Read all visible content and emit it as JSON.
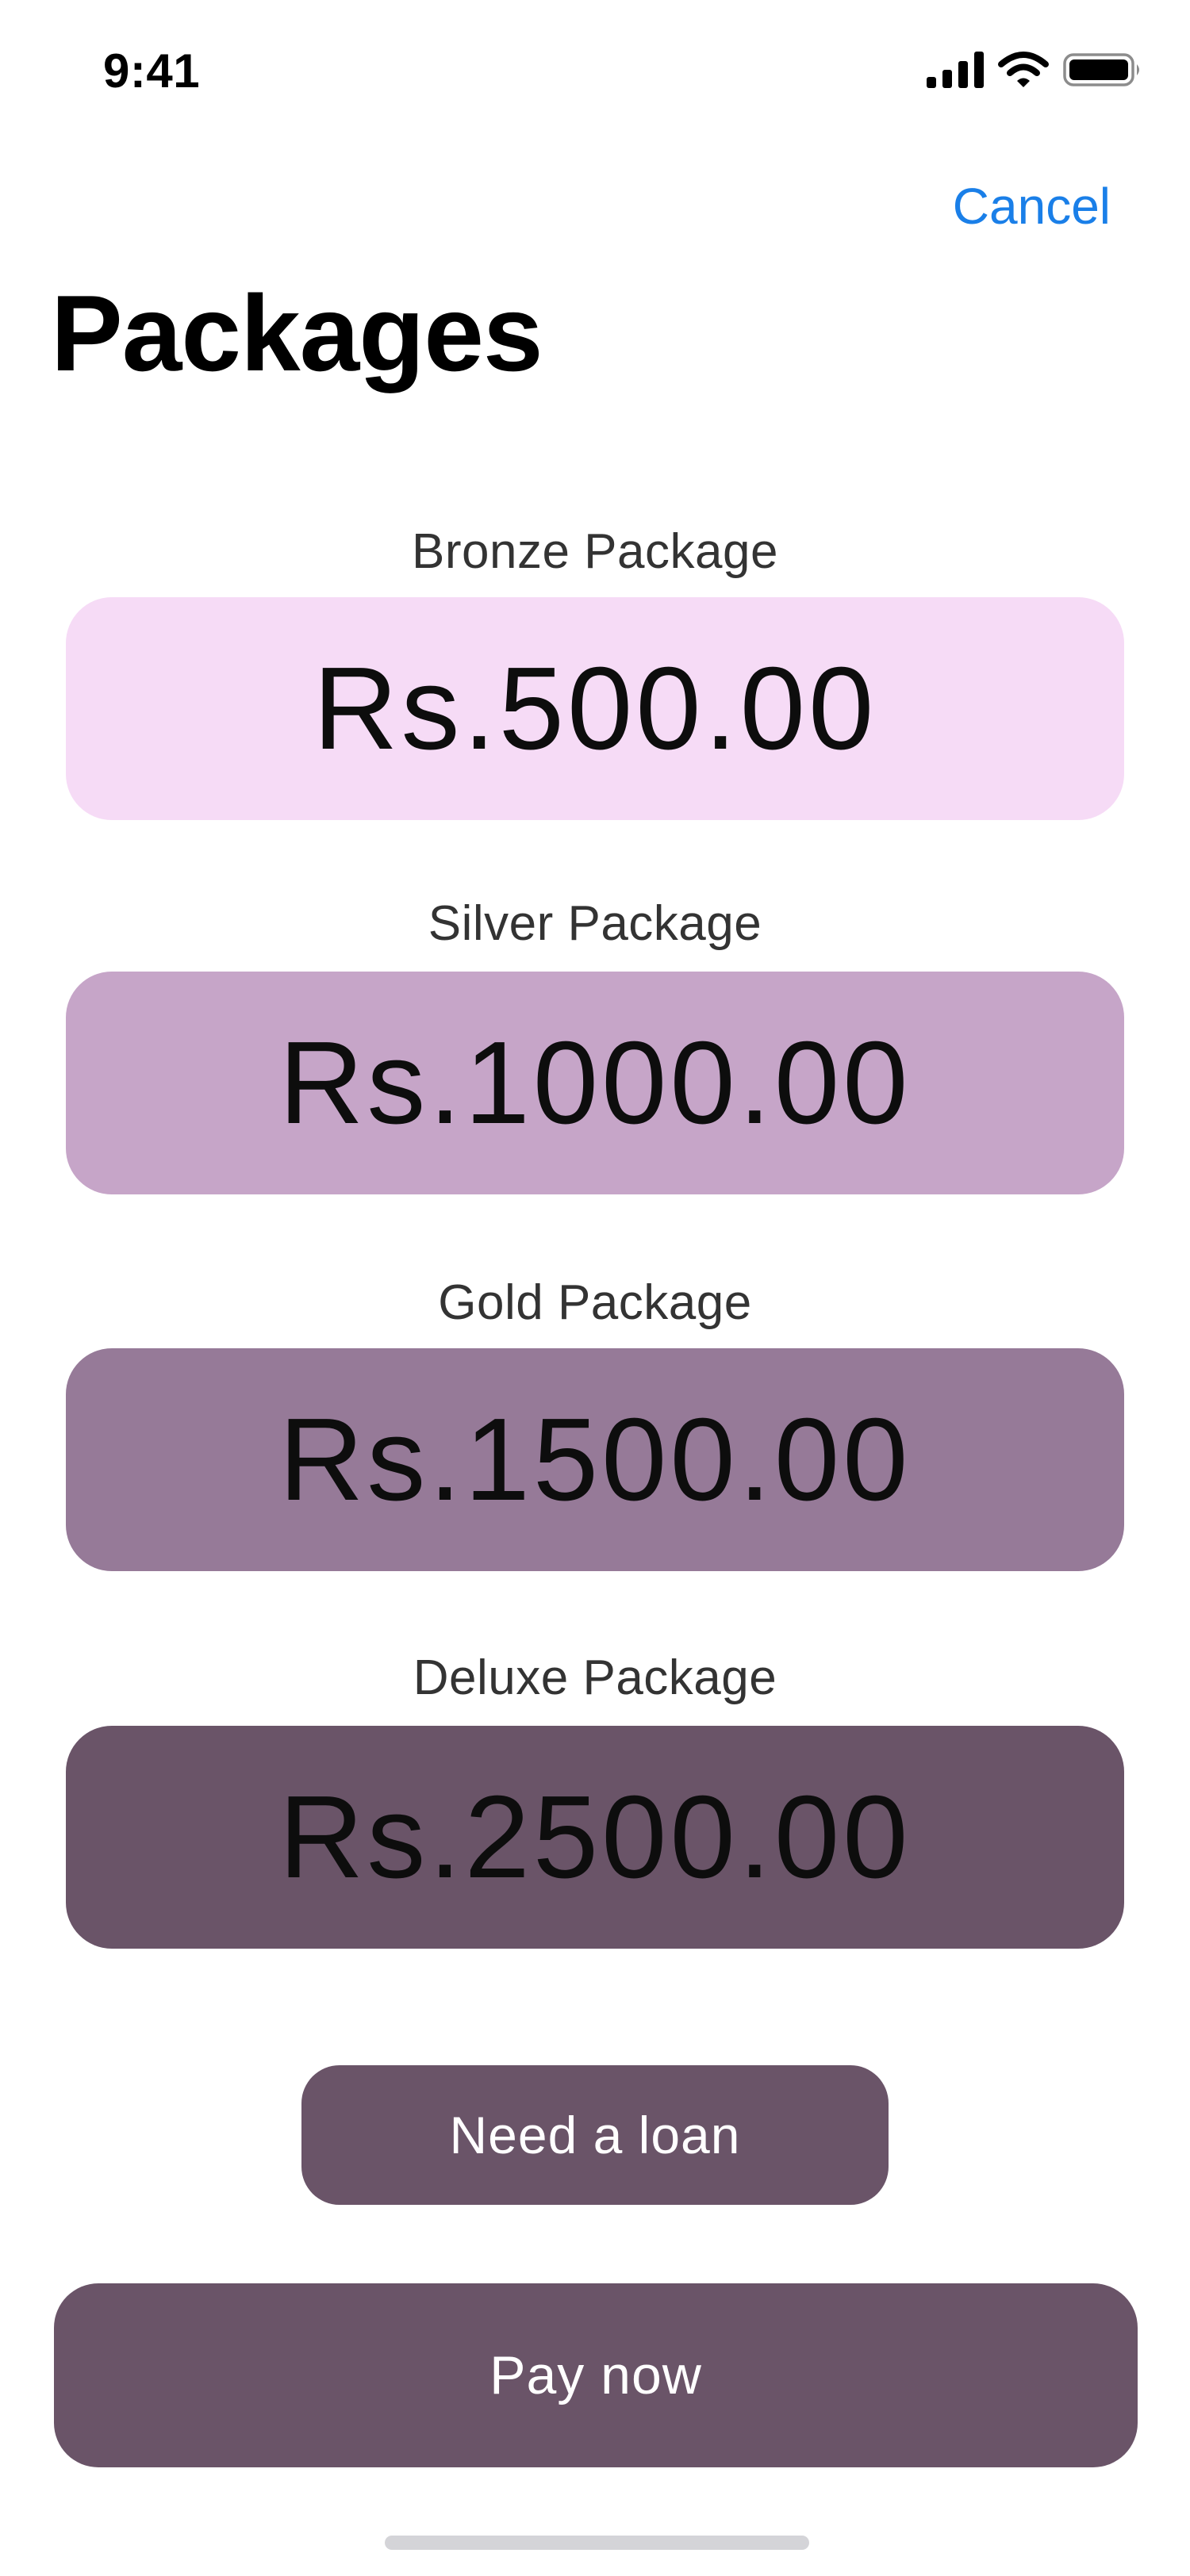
{
  "status_bar": {
    "time": "9:41",
    "signal_icon": "cellular-signal-icon",
    "wifi_icon": "wifi-icon",
    "battery_icon": "battery-icon"
  },
  "header": {
    "cancel_label": "Cancel",
    "title": "Packages"
  },
  "colors": {
    "accent": "#1a7fe8",
    "bronze": "#f6dbf6",
    "silver": "#c6a5c8",
    "gold": "#967a98",
    "deluxe": "#6a5468",
    "button": "#6a5468"
  },
  "packages": [
    {
      "label": "Bronze Package",
      "price": "Rs.500.00"
    },
    {
      "label": "Silver Package",
      "price": "Rs.1000.00"
    },
    {
      "label": "Gold Package",
      "price": "Rs.1500.00"
    },
    {
      "label": "Deluxe Package",
      "price": "Rs.2500.00"
    }
  ],
  "actions": {
    "loan_label": "Need a loan",
    "pay_label": "Pay now"
  }
}
